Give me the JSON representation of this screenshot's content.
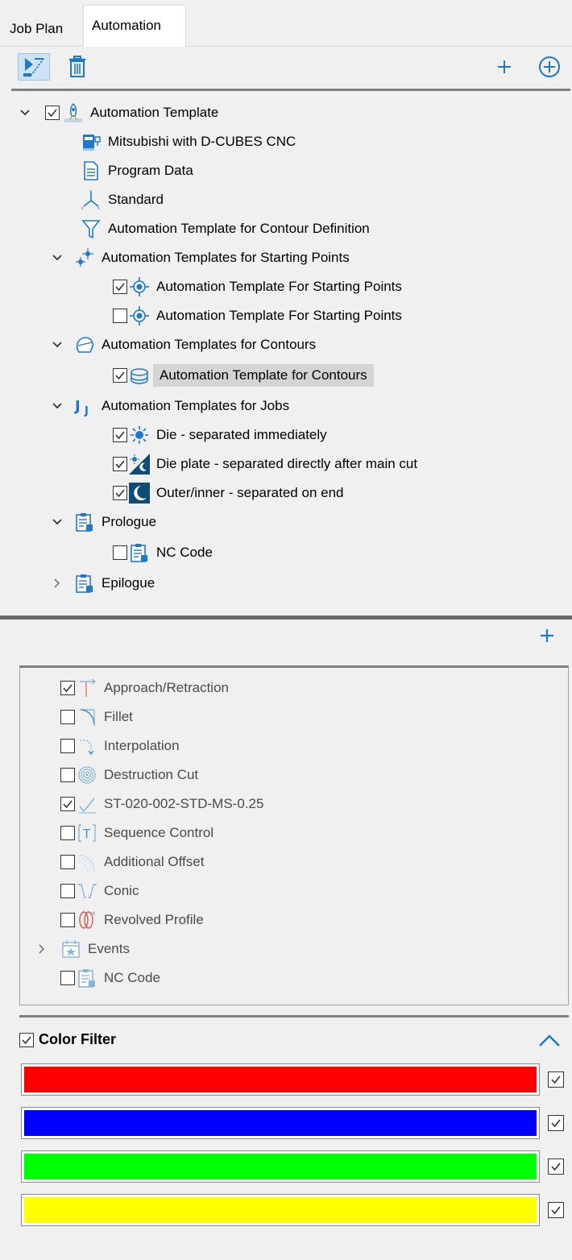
{
  "tabs": {
    "job_plan": "Job Plan",
    "automation": "Automation"
  },
  "tree": {
    "root": "Automation Template",
    "machine": "Mitsubishi with D-CUBES CNC",
    "program_data": "Program Data",
    "standard": "Standard",
    "contour_def": "Automation Template for Contour Definition",
    "starting_points_group": "Automation Templates for Starting Points",
    "starting_point_1": "Automation Template For Starting Points",
    "starting_point_2": "Automation Template For Starting Points",
    "contours_group": "Automation Templates for Contours",
    "contour_item": "Automation Template for Contours",
    "jobs_group": "Automation Templates for Jobs",
    "job_1": "Die - separated immediately",
    "job_2": "Die plate - separated directly after main cut",
    "job_3": "Outer/inner - separated on end",
    "prologue": "Prologue",
    "prologue_nc": "NC Code",
    "epilogue": "Epilogue"
  },
  "features": {
    "approach": "Approach/Retraction",
    "fillet": "Fillet",
    "interpolation": "Interpolation",
    "destruction": "Destruction Cut",
    "technology": "ST-020-002-STD-MS-0.25",
    "sequence": "Sequence Control",
    "offset": "Additional Offset",
    "conic": "Conic",
    "revolved": "Revolved Profile",
    "events": "Events",
    "nc_code": "NC Code"
  },
  "color_filter": {
    "label": "Color Filter",
    "colors": [
      "#ff0000",
      "#0000ff",
      "#00ff00",
      "#ffff00"
    ]
  },
  "colors": {
    "accent": "#1f78c8"
  }
}
